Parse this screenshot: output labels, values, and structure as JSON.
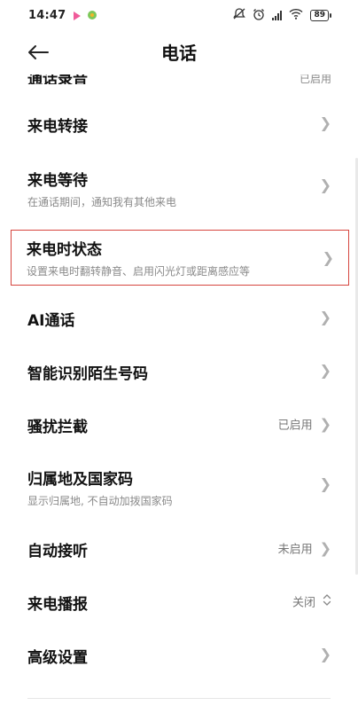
{
  "status_bar": {
    "time": "14:47",
    "battery": "89"
  },
  "header": {
    "title": "电话"
  },
  "list": {
    "clipped_label": "通话录音",
    "clipped_value": "已启用",
    "items": [
      {
        "title": "来电转接",
        "subtitle": "",
        "value": ""
      },
      {
        "title": "来电等待",
        "subtitle": "在通话期间，通知我有其他来电",
        "value": ""
      },
      {
        "title": "来电时状态",
        "subtitle": "设置来电时翻转静音、启用闪光灯或距离感应等",
        "value": ""
      },
      {
        "title": "AI通话",
        "subtitle": "",
        "value": ""
      },
      {
        "title": "智能识别陌生号码",
        "subtitle": "",
        "value": ""
      },
      {
        "title": "骚扰拦截",
        "subtitle": "",
        "value": "已启用"
      },
      {
        "title": "归属地及国家码",
        "subtitle": "显示归属地, 不自动加拨国家码",
        "value": ""
      },
      {
        "title": "自动接听",
        "subtitle": "",
        "value": "未启用"
      },
      {
        "title": "来电播报",
        "subtitle": "",
        "value": "关闭"
      },
      {
        "title": "高级设置",
        "subtitle": "",
        "value": ""
      }
    ]
  },
  "icons": {
    "back": "back-arrow-icon",
    "chevron": "chevron-right-icon",
    "updown": "up-down-chevron-icon"
  },
  "colors": {
    "highlight_border": "#d6453e",
    "secondary_text": "#8a8a8a"
  }
}
